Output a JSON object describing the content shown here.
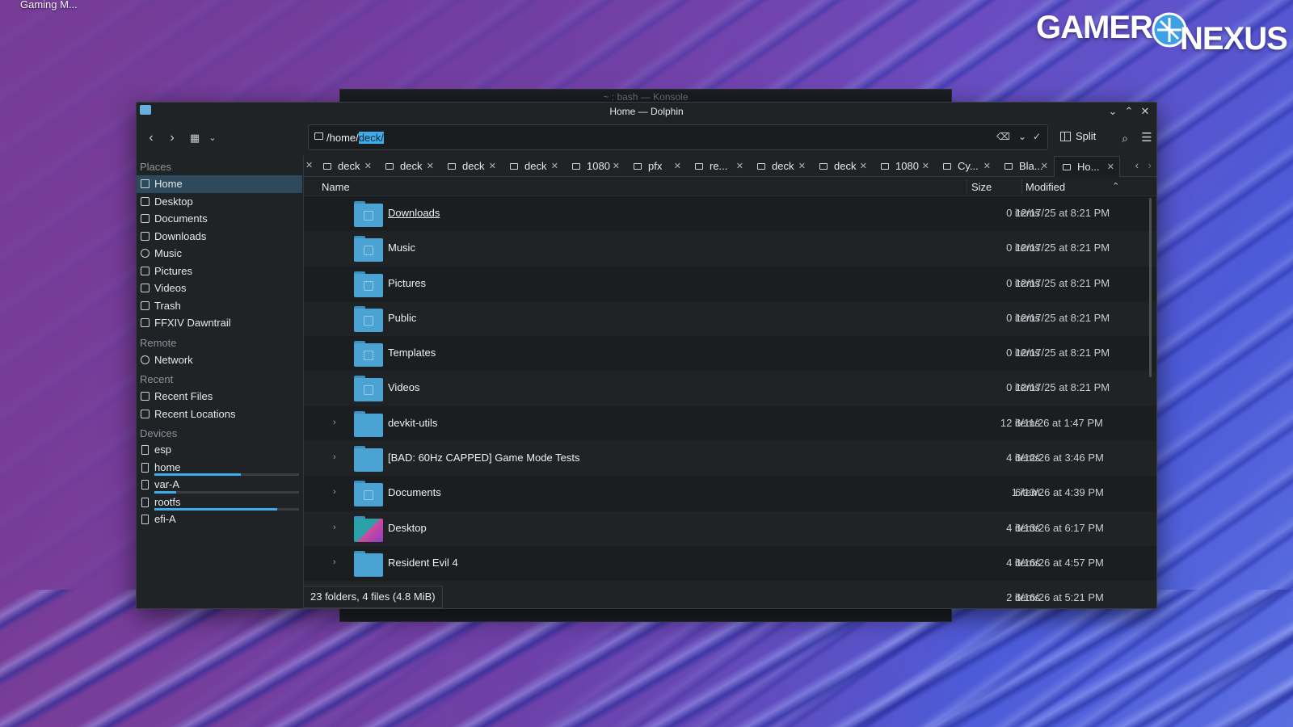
{
  "desktop": {
    "taskbar_label": "Gaming M...",
    "logo_left": "GAMERS",
    "logo_right": "NEXUS"
  },
  "konsole": {
    "title": "~ : bash — Konsole"
  },
  "window": {
    "title": "Home — Dolphin"
  },
  "toolbar": {
    "path_prefix": "/home/",
    "path_selected": "deck/",
    "split_label": "Split"
  },
  "sidebar": {
    "places_header": "Places",
    "places": [
      "Home",
      "Desktop",
      "Documents",
      "Downloads",
      "Music",
      "Pictures",
      "Videos",
      "Trash",
      "FFXIV Dawntrail"
    ],
    "remote_header": "Remote",
    "remote": [
      "Network"
    ],
    "recent_header": "Recent",
    "recent": [
      "Recent Files",
      "Recent Locations"
    ],
    "devices_header": "Devices",
    "devices": [
      {
        "name": "esp",
        "usage": 0
      },
      {
        "name": "home",
        "usage": 0.6
      },
      {
        "name": "var-A",
        "usage": 0.15
      },
      {
        "name": "rootfs",
        "usage": 0.85
      },
      {
        "name": "efi-A",
        "usage": 0
      }
    ]
  },
  "tabs": [
    "deck",
    "deck",
    "deck",
    "deck",
    "1080",
    "pfx",
    "re...",
    "deck",
    "deck",
    "1080",
    "Cy...",
    "Bla...",
    "Ho..."
  ],
  "columns": {
    "name": "Name",
    "size": "Size",
    "modified": "Modified"
  },
  "files": [
    {
      "name": "Downloads",
      "size": "0 items",
      "modified": "12/17/25 at 8:21 PM",
      "expandable": false
    },
    {
      "name": "Music",
      "size": "0 items",
      "modified": "12/17/25 at 8:21 PM",
      "expandable": false
    },
    {
      "name": "Pictures",
      "size": "0 items",
      "modified": "12/17/25 at 8:21 PM",
      "expandable": false
    },
    {
      "name": "Public",
      "size": "0 items",
      "modified": "12/17/25 at 8:21 PM",
      "expandable": false
    },
    {
      "name": "Templates",
      "size": "0 items",
      "modified": "12/17/25 at 8:21 PM",
      "expandable": false
    },
    {
      "name": "Videos",
      "size": "0 items",
      "modified": "12/17/25 at 8:21 PM",
      "expandable": false
    },
    {
      "name": "devkit-utils",
      "size": "12 items",
      "modified": "6/11/26 at 1:47 PM",
      "expandable": true
    },
    {
      "name": "[BAD: 60Hz CAPPED] Game Mode Tests",
      "size": "4 items",
      "modified": "6/12/26 at 3:46 PM",
      "expandable": true
    },
    {
      "name": "Documents",
      "size": "1 item",
      "modified": "6/13/26 at 4:39 PM",
      "expandable": true
    },
    {
      "name": "Desktop",
      "size": "4 items",
      "modified": "6/13/26 at 6:17 PM",
      "expandable": true
    },
    {
      "name": "Resident Evil 4",
      "size": "4 items",
      "modified": "6/16/26 at 4:57 PM",
      "expandable": true
    },
    {
      "name": "",
      "size": "2 items",
      "modified": "6/16/26 at 5:21 PM",
      "expandable": false
    }
  ],
  "status": "23 folders, 4 files (4.8 MiB)",
  "colors": {
    "accent": "#3daee9",
    "window_bg": "#202326",
    "view_bg": "#1b1e21"
  }
}
